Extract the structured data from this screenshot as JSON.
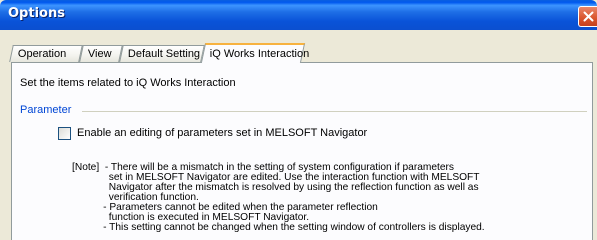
{
  "window": {
    "title": "Options"
  },
  "tabs": [
    {
      "label": "Operation"
    },
    {
      "label": "View"
    },
    {
      "label": "Default Setting"
    },
    {
      "label": "iQ Works Interaction"
    }
  ],
  "active_tab": "iQ Works Interaction",
  "panel": {
    "intro": "Set the items related to iQ Works Interaction",
    "group_label": "Parameter",
    "checkbox": {
      "label": "Enable an editing of parameters set in MELSOFT Navigator",
      "checked": false
    },
    "note_lines": [
      "[Note]  - There will be a mismatch in the setting of system configuration if parameters",
      "             set in MELSOFT Navigator are edited. Use the interaction function with MELSOFT",
      "             Navigator after the mismatch is resolved by using the reflection function as well as",
      "             verification function.",
      "           - Parameters cannot be edited when the parameter reflection",
      "             function is executed in MELSOFT Navigator.",
      "           - This setting cannot be changed when the setting window of controllers is displayed."
    ]
  },
  "colors": {
    "titlebar": "#0a53d9",
    "dialog_bg": "#ece9d8",
    "active_tab_accent": "#f7b23f",
    "group_label": "#0046d5",
    "close_button": "#d9542c"
  }
}
